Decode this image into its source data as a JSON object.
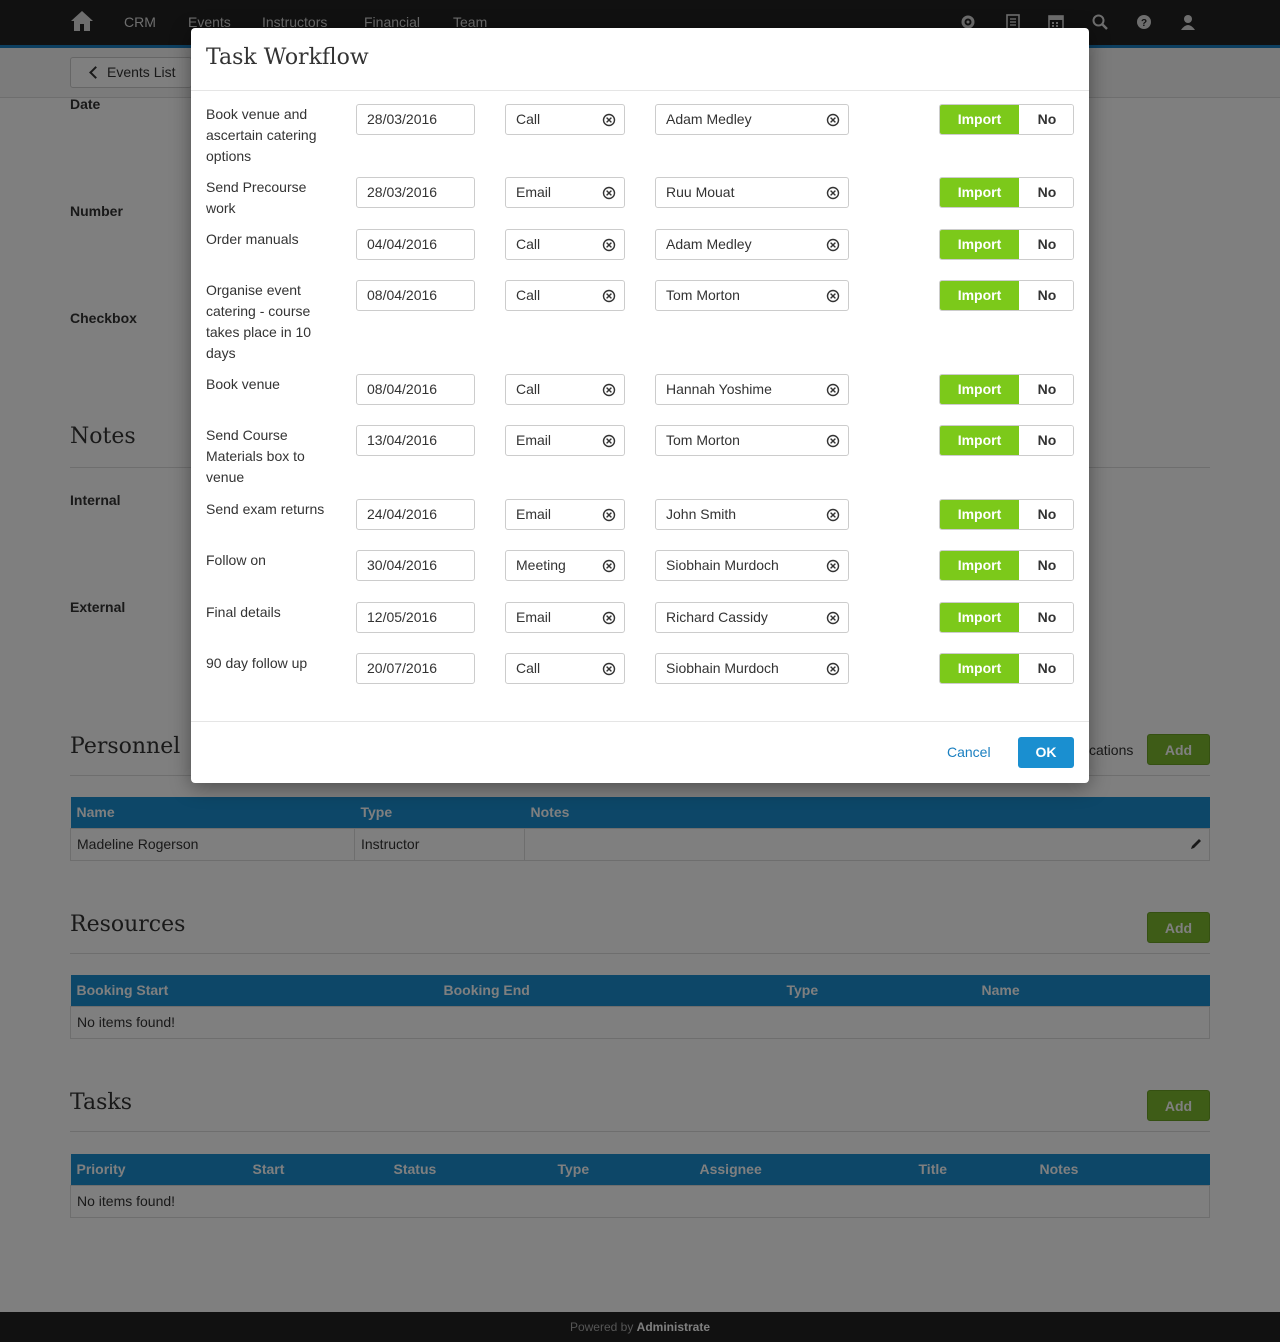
{
  "nav": {
    "links": [
      "CRM",
      "Events",
      "Instructors",
      "Financial",
      "Team"
    ]
  },
  "page": {
    "back_label": "Events List",
    "fields": [
      "Date",
      "Number",
      "Checkbox"
    ],
    "notes_title": "Notes",
    "notes_fields": [
      "Internal",
      "External"
    ],
    "personnel": {
      "title": "Personnel",
      "partial_link": "cations",
      "add_label": "Add",
      "columns": [
        "Name",
        "Type",
        "Notes"
      ],
      "rows": [
        [
          "Madeline Rogerson",
          "Instructor",
          ""
        ]
      ]
    },
    "resources": {
      "title": "Resources",
      "add_label": "Add",
      "columns": [
        "Booking Start",
        "Booking End",
        "Type",
        "Name"
      ],
      "empty": "No items found!"
    },
    "tasks": {
      "title": "Tasks",
      "add_label": "Add",
      "columns": [
        "Priority",
        "Start",
        "Status",
        "Type",
        "Assignee",
        "Title",
        "Notes"
      ],
      "empty": "No items found!"
    },
    "footer_prefix": "Powered by",
    "footer_brand": "Administrate"
  },
  "modal": {
    "title": "Task Workflow",
    "import_label": "Import",
    "no_label": "No",
    "cancel_label": "Cancel",
    "ok_label": "OK",
    "rows": [
      {
        "label": "Book venue and ascertain catering options",
        "date": "28/03/2016",
        "type": "Call",
        "person": "Adam Medley"
      },
      {
        "label": "Send Precourse work",
        "date": "28/03/2016",
        "type": "Email",
        "person": "Ruu Mouat"
      },
      {
        "label": "Order manuals",
        "date": "04/04/2016",
        "type": "Call",
        "person": "Adam Medley"
      },
      {
        "label": "Organise event catering - course takes place in 10 days",
        "date": "08/04/2016",
        "type": "Call",
        "person": "Tom Morton"
      },
      {
        "label": "Book venue",
        "date": "08/04/2016",
        "type": "Call",
        "person": "Hannah Yoshime"
      },
      {
        "label": "Send Course Materials box to venue",
        "date": "13/04/2016",
        "type": "Email",
        "person": "Tom Morton"
      },
      {
        "label": "Send exam returns",
        "date": "24/04/2016",
        "type": "Email",
        "person": "John Smith"
      },
      {
        "label": "Follow on",
        "date": "30/04/2016",
        "type": "Meeting",
        "person": "Siobhain Murdoch"
      },
      {
        "label": "Final details",
        "date": "12/05/2016",
        "type": "Email",
        "person": "Richard Cassidy"
      },
      {
        "label": "90 day follow up",
        "date": "20/07/2016",
        "type": "Call",
        "person": "Siobhain Murdoch"
      }
    ]
  },
  "colors": {
    "accent": "#1a8fd0",
    "import_green": "#7cc91a",
    "add_green": "#7cb82f",
    "nav_bg": "#222222"
  }
}
